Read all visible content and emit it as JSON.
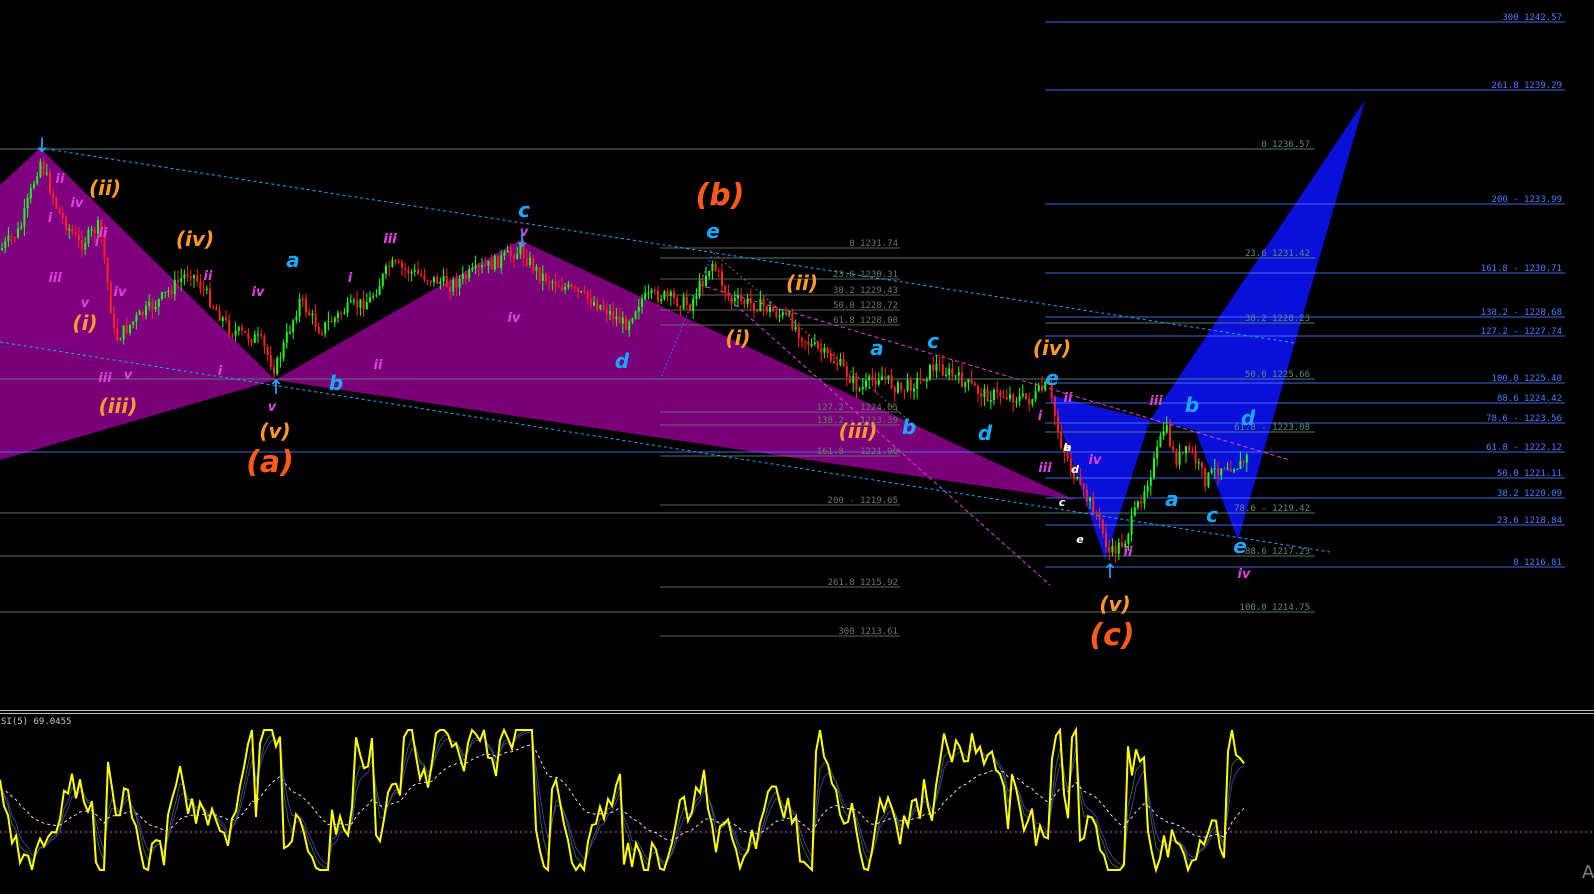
{
  "chart_data": {
    "type": "line",
    "price_levels": [
      {
        "label": "300 1242.57",
        "color": "#4a7cff",
        "group": "blue"
      },
      {
        "label": "261.8 1239.29",
        "color": "#4a7cff",
        "group": "blue"
      },
      {
        "label": "0 1236.57",
        "color": "#5a8c7a",
        "group": "green"
      },
      {
        "label": "200 - 1233.99",
        "color": "#4a7cff",
        "group": "blue"
      },
      {
        "label": "0 1231.74",
        "color": "#6a7a6a",
        "group": "gray"
      },
      {
        "label": "23.6 1231.42",
        "color": "#5a8c7a",
        "group": "green"
      },
      {
        "label": "161.8 - 1230.71",
        "color": "#4a7cff",
        "group": "blue"
      },
      {
        "label": "23.6 1230.31",
        "color": "#6a7a6a",
        "group": "gray"
      },
      {
        "label": "38.2 1229.43",
        "color": "#6a7a6a",
        "group": "gray"
      },
      {
        "label": "138.2 - 1228.68",
        "color": "#4a7cff",
        "group": "blue"
      },
      {
        "label": "50.0 1228.72",
        "color": "#6a7a6a",
        "group": "gray"
      },
      {
        "label": "38.2 1228.23",
        "color": "#5a8c7a",
        "group": "green"
      },
      {
        "label": "61.8 1228.00",
        "color": "#6a7a6a",
        "group": "gray"
      },
      {
        "label": "127.2 - 1227.74",
        "color": "#4a7cff",
        "group": "blue"
      },
      {
        "label": "50.0 1225.66",
        "color": "#5a8c7a",
        "group": "green"
      },
      {
        "label": "100.0 1225.40",
        "color": "#4a7cff",
        "group": "blue"
      },
      {
        "label": "88.6 1224.42",
        "color": "#4a7cff",
        "group": "blue"
      },
      {
        "label": "127.2 - 1224.05",
        "color": "#6a7a6a",
        "group": "gray"
      },
      {
        "label": "78.6 - 1223.56",
        "color": "#4a7cff",
        "group": "blue"
      },
      {
        "label": "138.2 - 1223.39",
        "color": "#6a7a6a",
        "group": "gray"
      },
      {
        "label": "61.8 - 1223.08",
        "color": "#5a8c7a",
        "group": "green"
      },
      {
        "label": "61.8 - 1222.12",
        "color": "#4a7cff",
        "group": "blue"
      },
      {
        "label": "161.8 - 1221.96",
        "color": "#6a7a6a",
        "group": "gray"
      },
      {
        "label": "50.0 1221.11",
        "color": "#4a7cff",
        "group": "blue"
      },
      {
        "label": "38.2 1220.09",
        "color": "#4a7cff",
        "group": "blue"
      },
      {
        "label": "200 - 1219.65",
        "color": "#6a7a6a",
        "group": "gray"
      },
      {
        "label": "78.6 - 1219.42",
        "color": "#5a8c7a",
        "group": "green"
      },
      {
        "label": "23.6 1218.84",
        "color": "#4a7cff",
        "group": "blue"
      },
      {
        "label": "88.6 1217.23",
        "color": "#5a8c7a",
        "group": "green"
      },
      {
        "label": "0 1216.81",
        "color": "#4a7cff",
        "group": "blue"
      },
      {
        "label": "261.8 1215.92",
        "color": "#6a7a6a",
        "group": "gray"
      },
      {
        "label": "100.0 1214.75",
        "color": "#5a8c7a",
        "group": "green"
      },
      {
        "label": "300 1213.61",
        "color": "#6a7a6a",
        "group": "gray"
      }
    ],
    "wave_labels": [
      {
        "text": "(a)",
        "color": "#ff5a1a",
        "size": "big"
      },
      {
        "text": "(b)",
        "color": "#ff5a1a",
        "size": "big"
      },
      {
        "text": "(c)",
        "color": "#ff5a1a",
        "size": "big"
      },
      {
        "text": "(i)",
        "color": "#ff9a2a",
        "size": "mid"
      },
      {
        "text": "(ii)",
        "color": "#ff9a2a",
        "size": "mid"
      },
      {
        "text": "(iii)",
        "color": "#ff9a2a",
        "size": "mid"
      },
      {
        "text": "(iv)",
        "color": "#ff9a2a",
        "size": "mid"
      },
      {
        "text": "(v)",
        "color": "#ff9a2a",
        "size": "mid"
      },
      {
        "text": "(i)",
        "color": "#ff9a2a",
        "size": "mid"
      },
      {
        "text": "(ii)",
        "color": "#ff9a2a",
        "size": "mid"
      },
      {
        "text": "(iii)",
        "color": "#ff9a2a",
        "size": "mid"
      },
      {
        "text": "(iv)",
        "color": "#ff9a2a",
        "size": "mid"
      },
      {
        "text": "(v)",
        "color": "#ff9a2a",
        "size": "mid"
      },
      {
        "text": "a",
        "color": "#1aa8ff",
        "size": "mid"
      },
      {
        "text": "b",
        "color": "#1aa8ff",
        "size": "mid"
      },
      {
        "text": "c",
        "color": "#1aa8ff",
        "size": "mid"
      },
      {
        "text": "d",
        "color": "#1aa8ff",
        "size": "mid"
      },
      {
        "text": "e",
        "color": "#1aa8ff",
        "size": "mid"
      },
      {
        "text": "a",
        "color": "#1aa8ff",
        "size": "mid"
      },
      {
        "text": "b",
        "color": "#1aa8ff",
        "size": "mid"
      },
      {
        "text": "c",
        "color": "#1aa8ff",
        "size": "mid"
      },
      {
        "text": "d",
        "color": "#1aa8ff",
        "size": "mid"
      },
      {
        "text": "e",
        "color": "#1aa8ff",
        "size": "mid"
      },
      {
        "text": "a",
        "color": "#1aa8ff",
        "size": "mid"
      },
      {
        "text": "b",
        "color": "#1aa8ff",
        "size": "mid"
      },
      {
        "text": "c",
        "color": "#1aa8ff",
        "size": "mid"
      },
      {
        "text": "d",
        "color": "#1aa8ff",
        "size": "mid"
      },
      {
        "text": "e",
        "color": "#1aa8ff",
        "size": "mid"
      },
      {
        "text": "i",
        "color": "#e040e0",
        "size": "small"
      },
      {
        "text": "ii",
        "color": "#e040e0",
        "size": "small"
      },
      {
        "text": "iii",
        "color": "#e040e0",
        "size": "small"
      },
      {
        "text": "iv",
        "color": "#e040e0",
        "size": "small"
      },
      {
        "text": "v",
        "color": "#e040e0",
        "size": "small"
      },
      {
        "text": "i",
        "color": "#e040e0",
        "size": "small"
      },
      {
        "text": "ii",
        "color": "#e040e0",
        "size": "small"
      },
      {
        "text": "iii",
        "color": "#e040e0",
        "size": "small"
      },
      {
        "text": "iv",
        "color": "#e040e0",
        "size": "small"
      },
      {
        "text": "v",
        "color": "#e040e0",
        "size": "small"
      },
      {
        "text": "i",
        "color": "#e040e0",
        "size": "small"
      },
      {
        "text": "ii",
        "color": "#e040e0",
        "size": "small"
      },
      {
        "text": "iii",
        "color": "#e040e0",
        "size": "small"
      },
      {
        "text": "iv",
        "color": "#e040e0",
        "size": "small"
      },
      {
        "text": "v",
        "color": "#e040e0",
        "size": "small"
      },
      {
        "text": "i",
        "color": "#e040e0",
        "size": "small"
      },
      {
        "text": "ii",
        "color": "#e040e0",
        "size": "small"
      },
      {
        "text": "iii",
        "color": "#e040e0",
        "size": "small"
      },
      {
        "text": "iv",
        "color": "#e040e0",
        "size": "small"
      },
      {
        "text": "v",
        "color": "#e040e0",
        "size": "small"
      },
      {
        "text": "i",
        "color": "#e040e0",
        "size": "small"
      },
      {
        "text": "ii",
        "color": "#e040e0",
        "size": "small"
      },
      {
        "text": "iii",
        "color": "#e040e0",
        "size": "small"
      },
      {
        "text": "iv",
        "color": "#e040e0",
        "size": "small"
      },
      {
        "text": "ii",
        "color": "#e040e0",
        "size": "small"
      },
      {
        "text": "iii",
        "color": "#e040e0",
        "size": "small"
      },
      {
        "text": "iv",
        "color": "#e040e0",
        "size": "small"
      },
      {
        "text": "a",
        "color": "#ffffff",
        "size": "tiny"
      },
      {
        "text": "b",
        "color": "#ffffff",
        "size": "tiny"
      },
      {
        "text": "c",
        "color": "#ffffff",
        "size": "tiny"
      },
      {
        "text": "d",
        "color": "#ffffff",
        "size": "tiny"
      },
      {
        "text": "e",
        "color": "#ffffff",
        "size": "tiny"
      }
    ],
    "rsi": {
      "label": "SI(5) 69.0455",
      "line_color": "#ffff00",
      "signal_color": "#e0e0e0"
    },
    "colors": {
      "background": "#000000",
      "bull_candle": "#1aff1a",
      "bear_candle": "#ff2020",
      "pattern_purple": "#800080",
      "pattern_blue": "#0a10d8",
      "trend_cyan": "#1aa8ff",
      "trend_magenta": "#e040e0"
    },
    "corner_text": "A"
  }
}
